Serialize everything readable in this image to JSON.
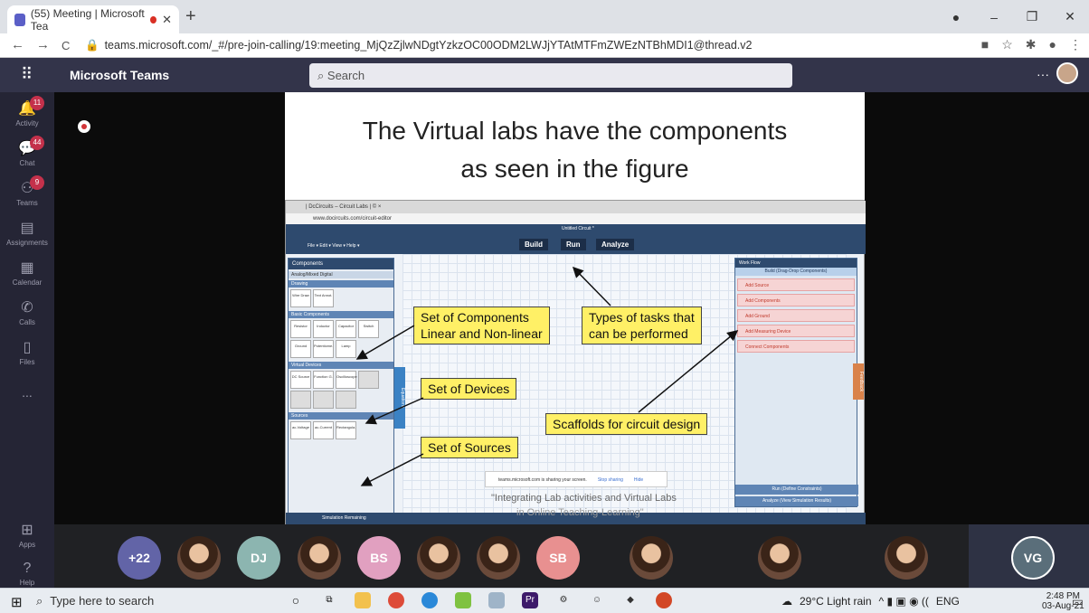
{
  "browser": {
    "tab_title": "(55) Meeting | Microsoft Tea",
    "new_tab": "+",
    "url": "teams.microsoft.com/_#/pre-join-calling/19:meeting_MjQzZjlwNDgtYzkzOC00ODM2LWJjYTAtMTFmZWEzNTBhMDI1@thread.v2",
    "window_controls": [
      "–",
      "❐",
      "✕"
    ]
  },
  "teams": {
    "app_name": "Microsoft Teams",
    "search_placeholder": "Search",
    "more": "···",
    "rail": [
      {
        "label": "Activity",
        "badge": "11",
        "icon": "bell-icon"
      },
      {
        "label": "Chat",
        "badge": "44",
        "icon": "chat-icon"
      },
      {
        "label": "Teams",
        "badge": "9",
        "icon": "teams-icon"
      },
      {
        "label": "Assignments",
        "badge": "",
        "icon": "assignments-icon"
      },
      {
        "label": "Calendar",
        "badge": "",
        "icon": "calendar-icon"
      },
      {
        "label": "Calls",
        "badge": "",
        "icon": "phone-icon"
      },
      {
        "label": "Files",
        "badge": "",
        "icon": "files-icon"
      },
      {
        "label": "...",
        "badge": "",
        "icon": "more-icon"
      }
    ],
    "rail_bottom": [
      {
        "label": "Apps",
        "icon": "apps-icon"
      },
      {
        "label": "Help",
        "icon": "help-icon"
      }
    ]
  },
  "slide": {
    "title_line1": "The Virtual labs have the components",
    "title_line2": "as seen in the figure",
    "callouts": {
      "components_l1": "Set of Components",
      "components_l2": "Linear and Non-linear",
      "tasks_l1": "Types of tasks that",
      "tasks_l2": "can be performed",
      "devices": "Set of Devices",
      "scaffolds": "Scaffolds for circuit design",
      "sources": "Set of Sources"
    },
    "caption_line1": "\"Integrating Lab activities and Virtual Labs",
    "caption_line2": "in Online Teaching-Learning\"",
    "screenshot": {
      "tab": "| DcCircuits – Circuit Labs | © ×",
      "url": "www.docircuits.com/circuit-editor",
      "doc_title": "Untitled Circuit *",
      "menus": "File ▾  Edit ▾  View ▾  Help ▾",
      "build": "Build",
      "run": "Run",
      "analyze": "Analyze",
      "components_header": "Components",
      "tabs": "Analog/Mixed    Digital",
      "sections": [
        "Drawing",
        "Basic Components",
        "Virtual Devices",
        "Sources"
      ],
      "drawing_items": [
        "Wire Draw",
        "Text Annot."
      ],
      "basic_items": [
        "Resistor",
        "Inductor",
        "Capacitor",
        "Switch",
        "Ground",
        "Potentiome.",
        "Lamp"
      ],
      "device_items": [
        "DC Source",
        "Function G.",
        "Oscilloscope",
        "",
        "",
        "",
        ""
      ],
      "source_items": [
        "ac-Voltage",
        "ac-Current",
        "Rectangula.",
        "",
        "",
        ""
      ],
      "equations_tab": "Equations",
      "feedback_tab": "Feedback",
      "workflow_header": "Work Flow",
      "workflow_build": "Build (Drag-Drop Components)",
      "workflow_items": [
        "Add Source",
        "Add Components",
        "Add Ground",
        "Add Measuring Device",
        "Connect Components"
      ],
      "workflow_run": "Run (Define Constraints)",
      "workflow_analyze": "Analyze (View Simulation Results)",
      "footer": "Simulation Remaining"
    },
    "share_bar": {
      "message": "teams.microsoft.com is sharing your screen.",
      "stop": "Stop sharing",
      "hide": "Hide"
    }
  },
  "participants": [
    {
      "initials": "+22",
      "color": "#6264a7",
      "photo": false
    },
    {
      "initials": "",
      "color": "",
      "photo": true
    },
    {
      "initials": "DJ",
      "color": "#8cb5b0",
      "photo": false
    },
    {
      "initials": "",
      "color": "",
      "photo": true
    },
    {
      "initials": "BS",
      "color": "#e1a0c0",
      "photo": false
    },
    {
      "initials": "",
      "color": "",
      "photo": true
    },
    {
      "initials": "",
      "color": "",
      "photo": true
    },
    {
      "initials": "SB",
      "color": "#e89090",
      "photo": false
    },
    {
      "initials": "",
      "color": "",
      "photo": true
    },
    {
      "initials": "",
      "color": "",
      "photo": true
    },
    {
      "initials": "",
      "color": "",
      "photo": true
    },
    {
      "initials": "VG",
      "color": "#5a6e7a",
      "photo": false
    }
  ],
  "taskbar": {
    "search_placeholder": "Type here to search",
    "weather": "29°C  Light rain",
    "lang": "ENG",
    "time": "2:48 PM",
    "date": "03-Aug-21"
  }
}
